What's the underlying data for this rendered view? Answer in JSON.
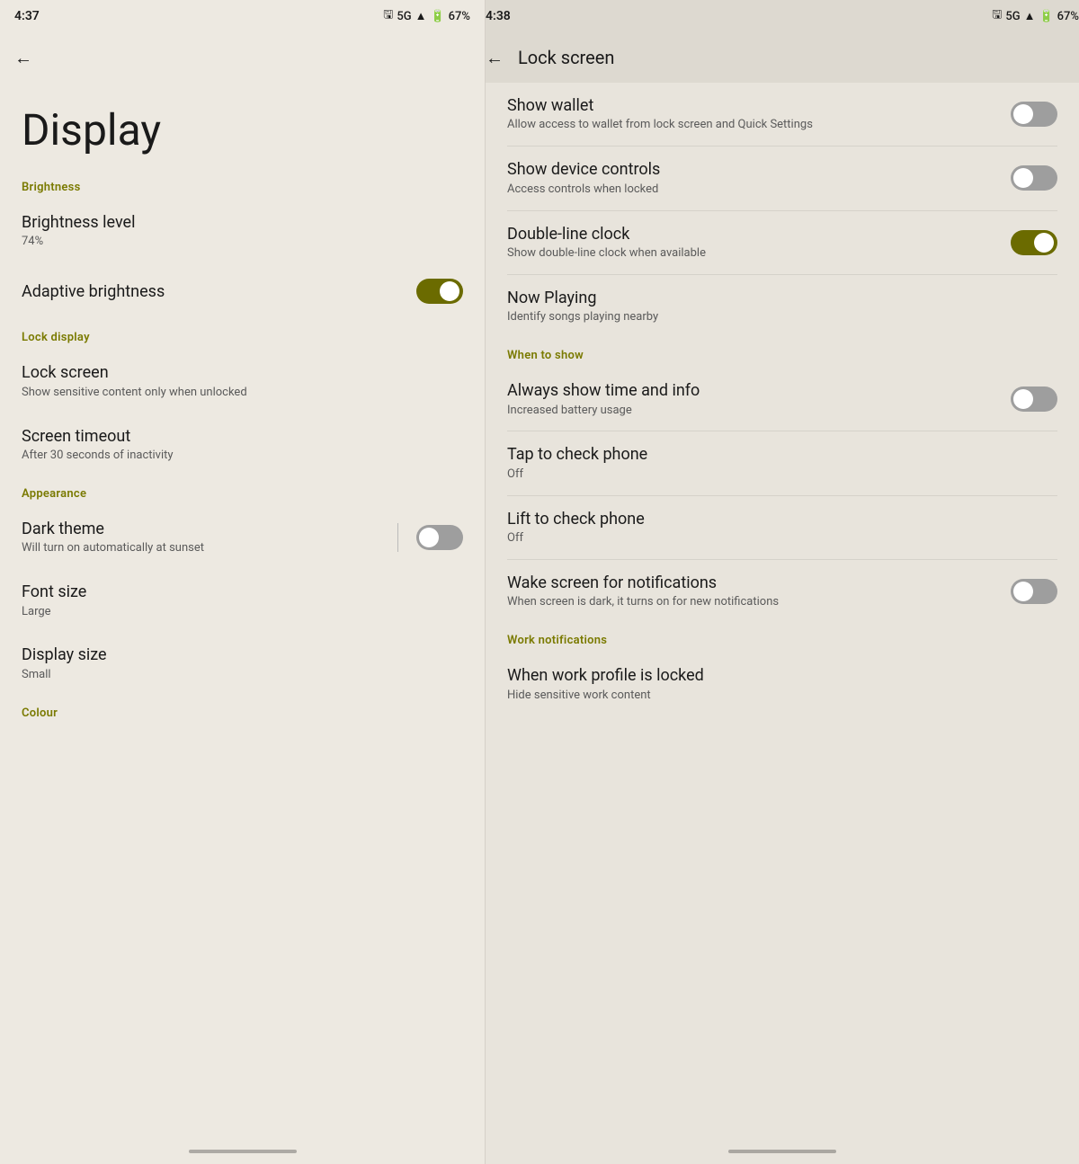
{
  "left": {
    "status": {
      "time": "4:37",
      "signal": "5G",
      "battery": "67%"
    },
    "page_title": "Display",
    "sections": [
      {
        "label": "Brightness",
        "items": [
          {
            "title": "Brightness level",
            "subtitle": "74%",
            "toggle": null
          },
          {
            "title": "Adaptive brightness",
            "subtitle": null,
            "toggle": "on"
          }
        ]
      },
      {
        "label": "Lock display",
        "items": [
          {
            "title": "Lock screen",
            "subtitle": "Show sensitive content only when unlocked",
            "toggle": null
          },
          {
            "title": "Screen timeout",
            "subtitle": "After 30 seconds of inactivity",
            "toggle": null
          }
        ]
      },
      {
        "label": "Appearance",
        "items": [
          {
            "title": "Dark theme",
            "subtitle": "Will turn on automatically at sunset",
            "toggle": "off"
          },
          {
            "title": "Font size",
            "subtitle": "Large",
            "toggle": null
          },
          {
            "title": "Display size",
            "subtitle": "Small",
            "toggle": null
          }
        ]
      },
      {
        "label": "Colour",
        "items": []
      }
    ]
  },
  "right": {
    "status": {
      "time": "4:38",
      "signal": "5G",
      "battery": "67%"
    },
    "page_title": "Lock screen",
    "back_label": "←",
    "items": [
      {
        "title": "Show wallet",
        "subtitle": "Allow access to wallet from lock screen and Quick Settings",
        "toggle": "off",
        "section_before": null
      },
      {
        "title": "Show device controls",
        "subtitle": "Access controls when locked",
        "toggle": "off",
        "section_before": null
      },
      {
        "title": "Double-line clock",
        "subtitle": "Show double-line clock when available",
        "toggle": "on",
        "section_before": null
      },
      {
        "title": "Now Playing",
        "subtitle": "Identify songs playing nearby",
        "toggle": null,
        "section_before": null
      }
    ],
    "when_to_show_label": "When to show",
    "when_items": [
      {
        "title": "Always show time and info",
        "subtitle": "Increased battery usage",
        "toggle": "off"
      },
      {
        "title": "Tap to check phone",
        "subtitle": "Off",
        "toggle": null
      },
      {
        "title": "Lift to check phone",
        "subtitle": "Off",
        "toggle": null
      },
      {
        "title": "Wake screen for notifications",
        "subtitle": "When screen is dark, it turns on for new notifications",
        "toggle": "off"
      }
    ],
    "work_notifications_label": "Work notifications",
    "work_items": [
      {
        "title": "When work profile is locked",
        "subtitle": "Hide sensitive work content",
        "toggle": null
      }
    ]
  }
}
